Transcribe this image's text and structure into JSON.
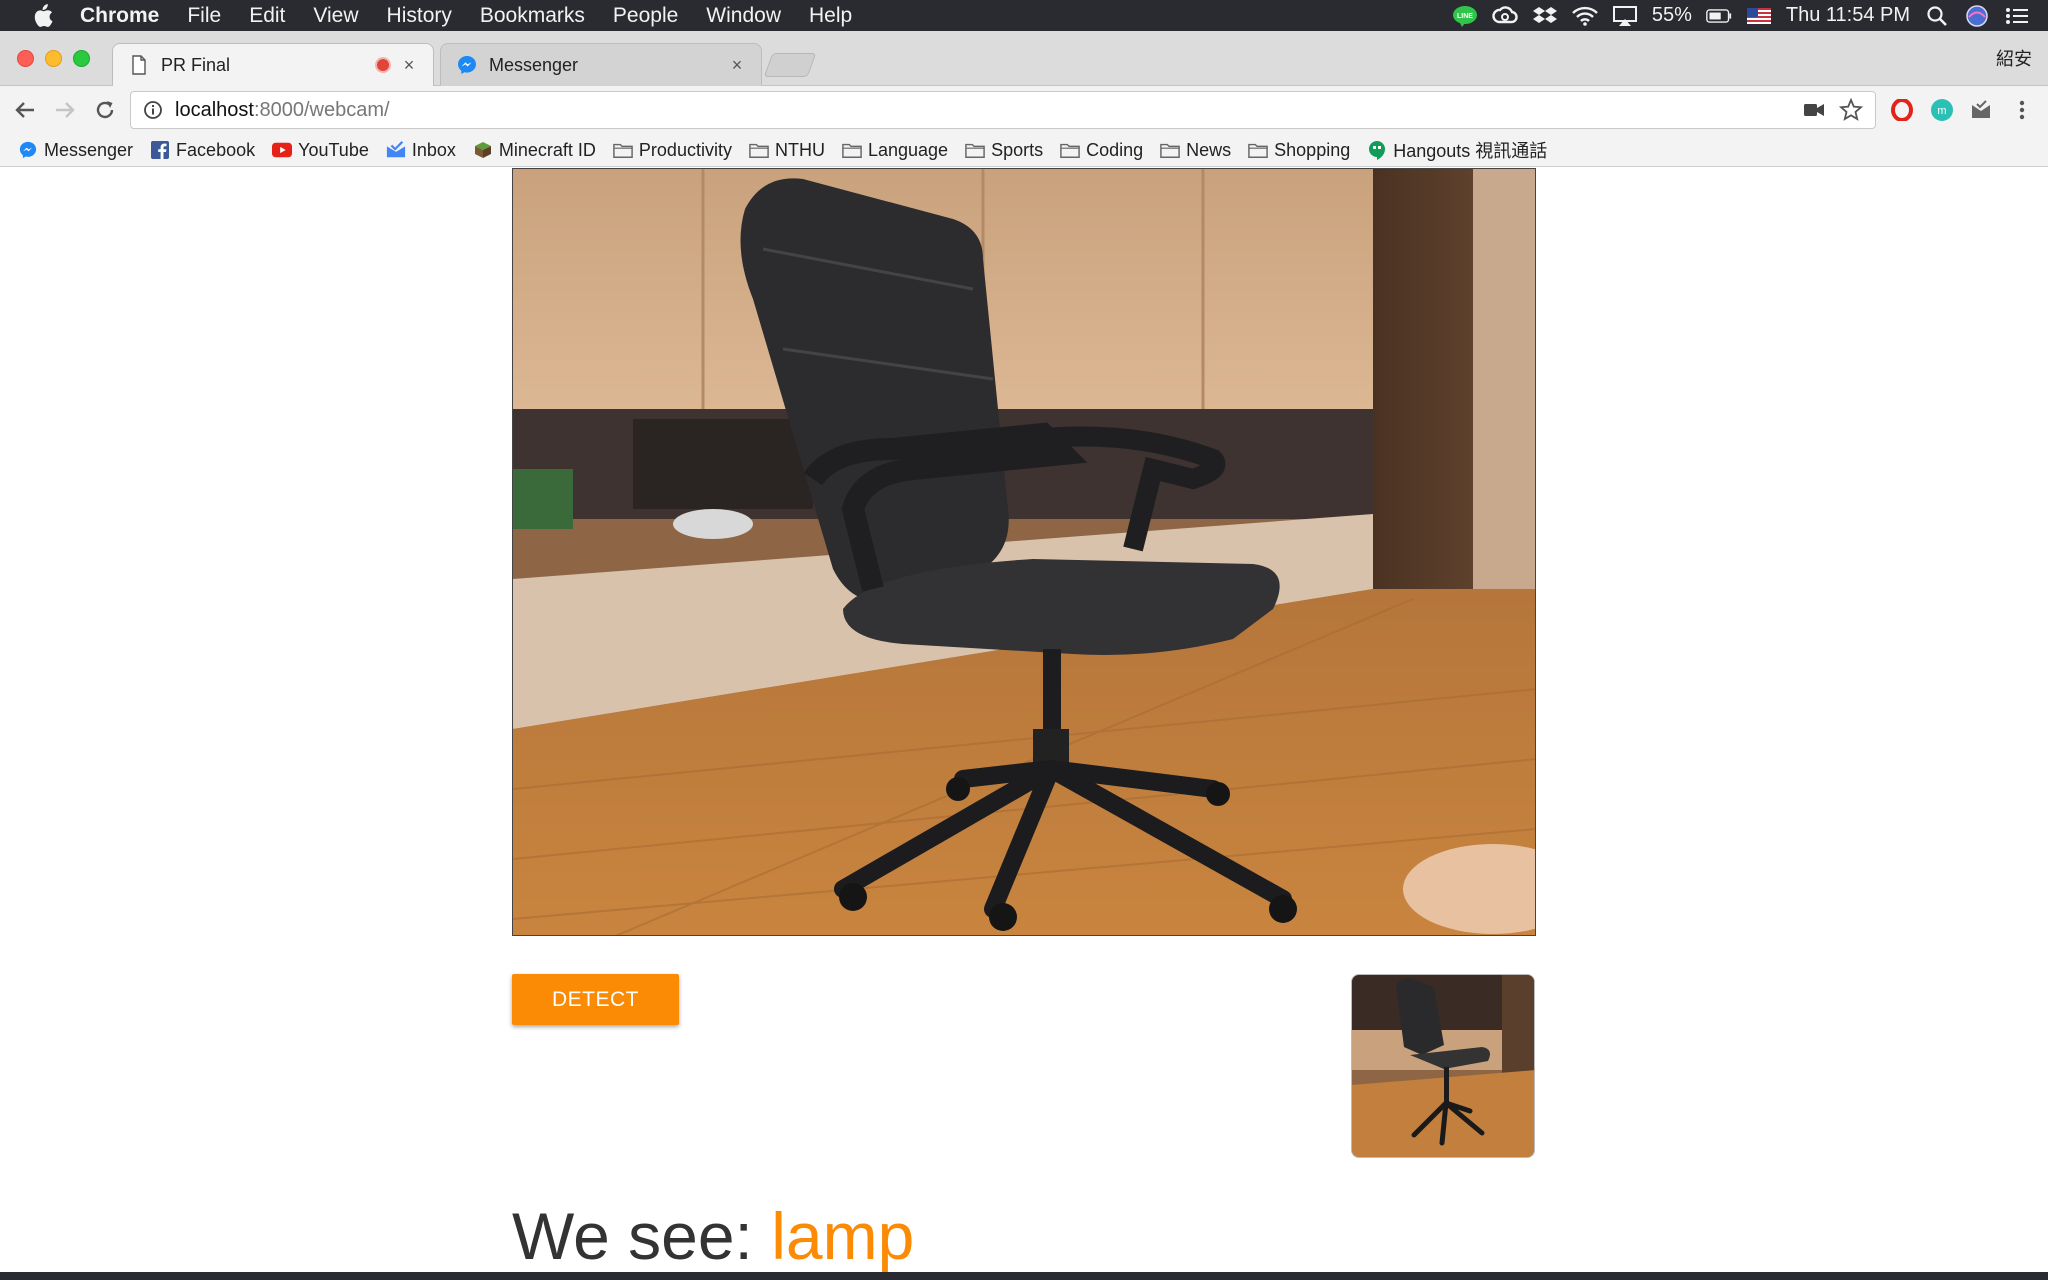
{
  "menubar": {
    "app_name": "Chrome",
    "menus": [
      "File",
      "Edit",
      "View",
      "History",
      "Bookmarks",
      "People",
      "Window",
      "Help"
    ],
    "battery": "55%",
    "clock": "Thu 11:54 PM"
  },
  "tabs": [
    {
      "title": "PR Final",
      "recording": true
    },
    {
      "title": "Messenger"
    }
  ],
  "profile_name": "紹安",
  "address_bar": {
    "url_host": "localhost",
    "url_rest": ":8000/webcam/"
  },
  "bookmarks": [
    {
      "label": "Messenger",
      "icon": "messenger-icon"
    },
    {
      "label": "Facebook",
      "icon": "facebook-icon"
    },
    {
      "label": "YouTube",
      "icon": "youtube-icon"
    },
    {
      "label": "Inbox",
      "icon": "inbox-icon"
    },
    {
      "label": "Minecraft ID",
      "icon": "minecraft-icon"
    },
    {
      "label": "Productivity",
      "icon": "folder-icon"
    },
    {
      "label": "NTHU",
      "icon": "folder-icon"
    },
    {
      "label": "Language",
      "icon": "folder-icon"
    },
    {
      "label": "Sports",
      "icon": "folder-icon"
    },
    {
      "label": "Coding",
      "icon": "folder-icon"
    },
    {
      "label": "News",
      "icon": "folder-icon"
    },
    {
      "label": "Shopping",
      "icon": "folder-icon"
    },
    {
      "label": "Hangouts 視訊通話",
      "icon": "hangouts-icon"
    }
  ],
  "main": {
    "detect_label": "DETECT",
    "result_prefix": "We see: ",
    "result_value": "lamp"
  },
  "colors": {
    "accent": "#fb8a05",
    "menubar_bg": "#2a2b30"
  }
}
